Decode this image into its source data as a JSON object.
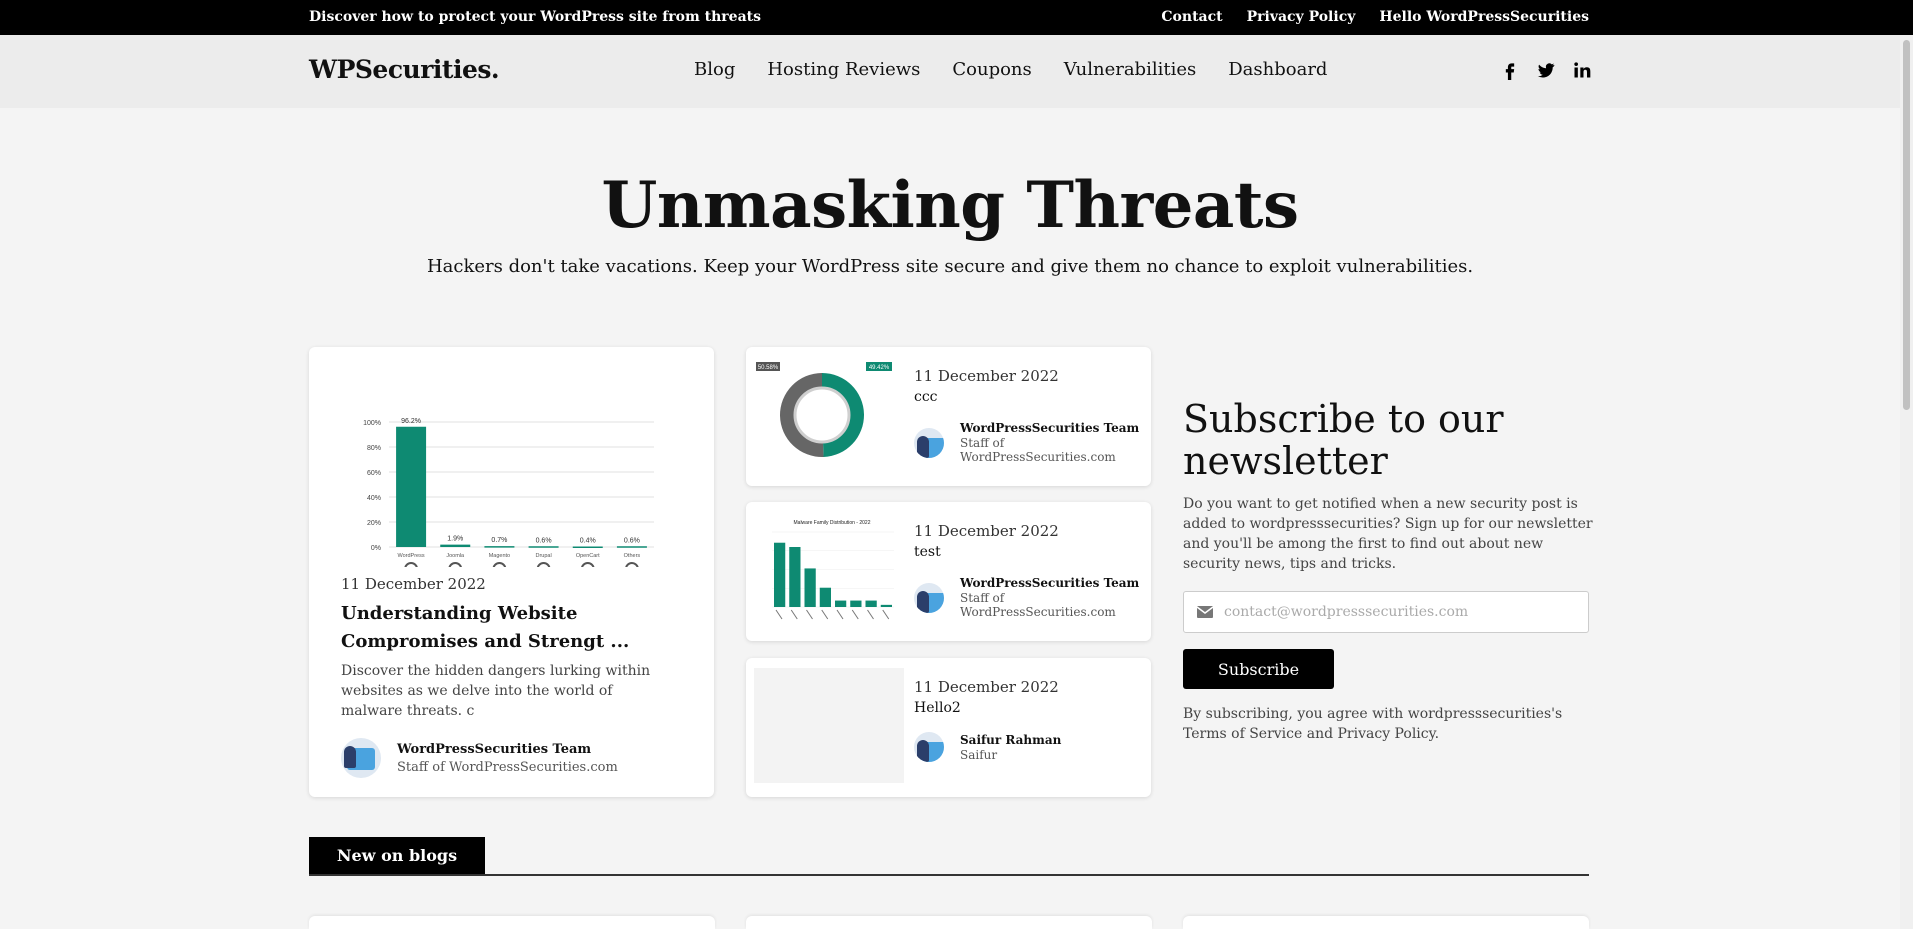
{
  "topbar": {
    "message": "Discover how to protect your WordPress site from threats",
    "links": [
      "Contact",
      "Privacy Policy",
      "Hello WordPressSecurities"
    ]
  },
  "header": {
    "logo": "WPSecurities.",
    "nav": [
      "Blog",
      "Hosting Reviews",
      "Coupons",
      "Vulnerabilities",
      "Dashboard"
    ],
    "social_icons": [
      "facebook-icon",
      "twitter-icon",
      "linkedin-icon"
    ]
  },
  "hero": {
    "title": "Unmasking Threats",
    "subtitle": "Hackers don't take vacations. Keep your WordPress site secure and give them no chance to exploit vulnerabilities."
  },
  "featured_post": {
    "date": "11 December 2022",
    "title": "Understanding Website Compromises and Strengt ...",
    "excerpt": "Discover the hidden dangers lurking within websites as we delve into the world of malware threats. c",
    "author_name": "WordPressSecurities Team",
    "author_role": "Staff of WordPressSecurities.com"
  },
  "side_posts": [
    {
      "date": "11 December 2022",
      "title": "ccc",
      "author_name": "WordPressSecurities Team",
      "author_role": "Staff of WordPressSecurities.com"
    },
    {
      "date": "11 December 2022",
      "title": "test",
      "author_name": "WordPressSecurities Team",
      "author_role": "Staff of WordPressSecurities.com"
    },
    {
      "date": "11 December 2022",
      "title": "Hello2",
      "author_name": "Saifur Rahman",
      "author_role": "Saifur"
    }
  ],
  "newsletter": {
    "title": "Subscribe to our newsletter",
    "text": "Do you want to get notified when a new security post is added to wordpresssecurities? Sign up for our newsletter and you'll be among the first to find out about new security news, tips and tricks.",
    "email_placeholder": "contact@wordpresssecurities.com",
    "button": "Subscribe",
    "terms": "By subscribing, you agree with wordpresssecurities's Terms of Service and Privacy Policy."
  },
  "section_tab": "New on blogs",
  "colors": {
    "accent": "#0e8a72",
    "black": "#000000",
    "donut_gray": "#666666"
  },
  "chart_data": [
    {
      "type": "bar",
      "categories": [
        "WordPress",
        "Joomla",
        "Magento",
        "Drupal",
        "OpenCart",
        "Others"
      ],
      "values": [
        96.2,
        1.9,
        0.7,
        0.6,
        0.4,
        0.6
      ],
      "value_labels": [
        "96.2%",
        "1.9%",
        "0.7%",
        "0.6%",
        "0.4%",
        "0.6%"
      ],
      "y_ticks": [
        "0%",
        "20%",
        "40%",
        "60%",
        "80%",
        "100%"
      ],
      "ylim": [
        0,
        100
      ],
      "title": "",
      "xlabel": "",
      "ylabel": ""
    },
    {
      "type": "pie",
      "values": [
        49.42,
        50.58
      ],
      "labels": [
        "49.42%",
        "50.58%"
      ]
    },
    {
      "type": "bar",
      "title": "Malware Family Distribution - 2022",
      "values": [
        30,
        28,
        18,
        9,
        3,
        3,
        3,
        1
      ]
    }
  ]
}
